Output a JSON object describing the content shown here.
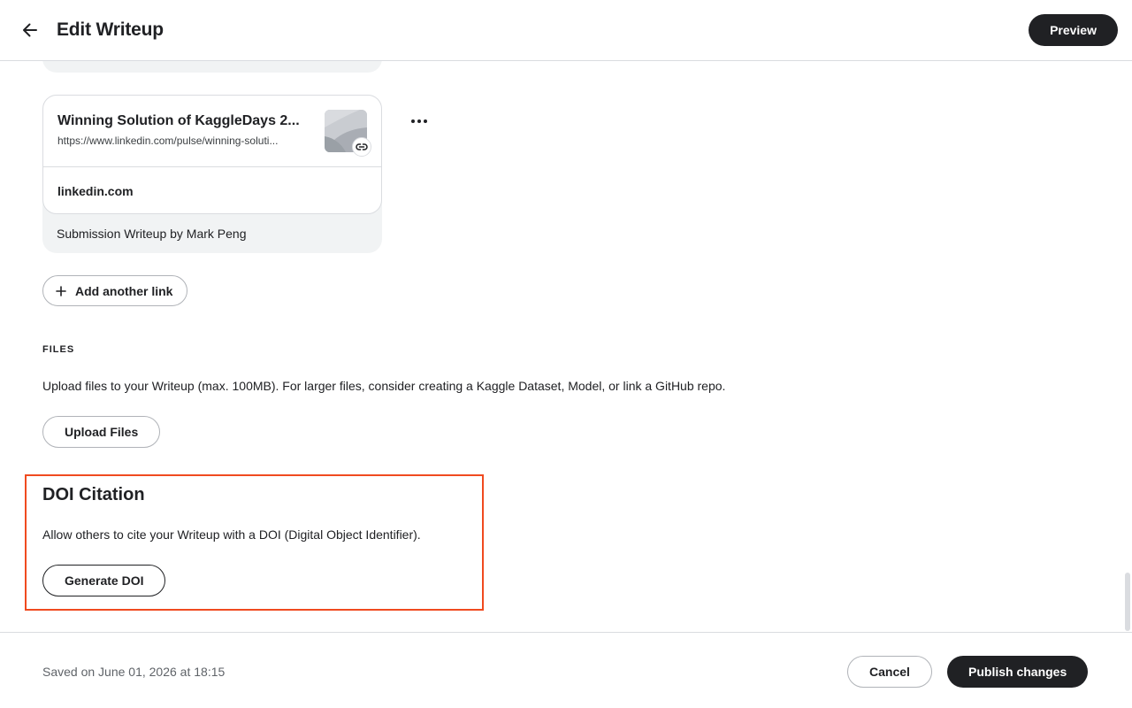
{
  "header": {
    "back_icon": "arrow-left-icon",
    "title": "Edit Writeup",
    "preview_label": "Preview"
  },
  "link_card": {
    "title": "Winning Solution of KaggleDays 2...",
    "url": "https://www.linkedin.com/pulse/winning-soluti...",
    "domain": "linkedin.com",
    "caption": "Submission Writeup by Mark Peng",
    "thumbnail_icon": "link-icon",
    "more_icon": "more-horizontal-icon"
  },
  "add_link": {
    "icon": "plus-icon",
    "label": "Add another link"
  },
  "files": {
    "heading": "FILES",
    "description": "Upload files to your Writeup (max. 100MB). For larger files, consider creating a Kaggle Dataset, Model, or link a GitHub repo.",
    "upload_label": "Upload Files"
  },
  "doi": {
    "title": "DOI Citation",
    "description": "Allow others to cite your Writeup with a DOI (Digital Object Identifier).",
    "button_label": "Generate DOI",
    "highlight_color": "#f04a1f"
  },
  "footer": {
    "saved_text": "Saved on June 01, 2026 at 18:15",
    "cancel_label": "Cancel",
    "publish_label": "Publish changes"
  },
  "colors": {
    "primary_dark": "#202124",
    "card_bg": "#f1f3f4",
    "border": "#dadce0"
  }
}
